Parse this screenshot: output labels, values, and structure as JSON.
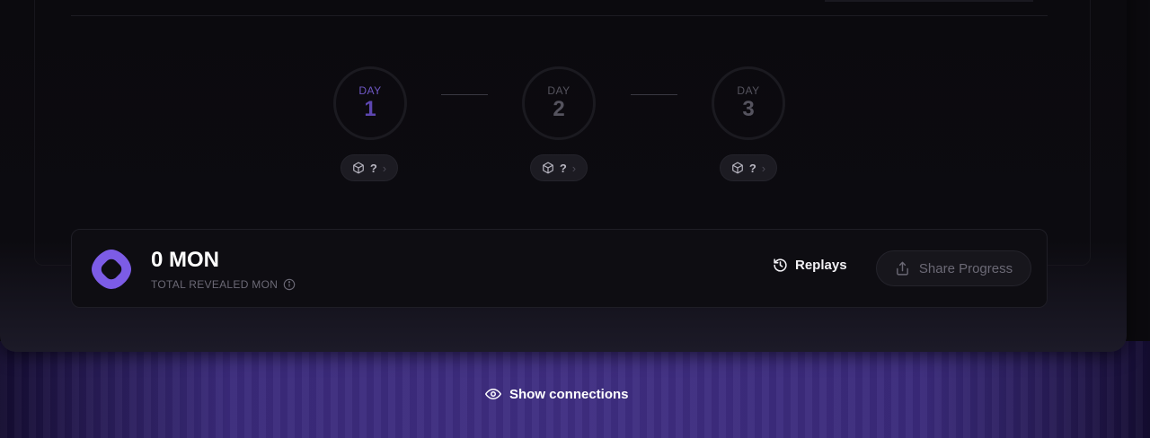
{
  "days": [
    {
      "label": "DAY",
      "number": "1",
      "active": true,
      "chip_value": "?"
    },
    {
      "label": "DAY",
      "number": "2",
      "active": false,
      "chip_value": "?"
    },
    {
      "label": "DAY",
      "number": "3",
      "active": false,
      "chip_value": "?"
    }
  ],
  "stats": {
    "amount": "0 MON",
    "amount_label": "TOTAL REVEALED MON",
    "replays_label": "Replays",
    "share_label": "Share Progress"
  },
  "footer": {
    "show_connections_label": "Show connections"
  },
  "colors": {
    "accent": "#7c5ce6",
    "glow": "#48349a"
  }
}
